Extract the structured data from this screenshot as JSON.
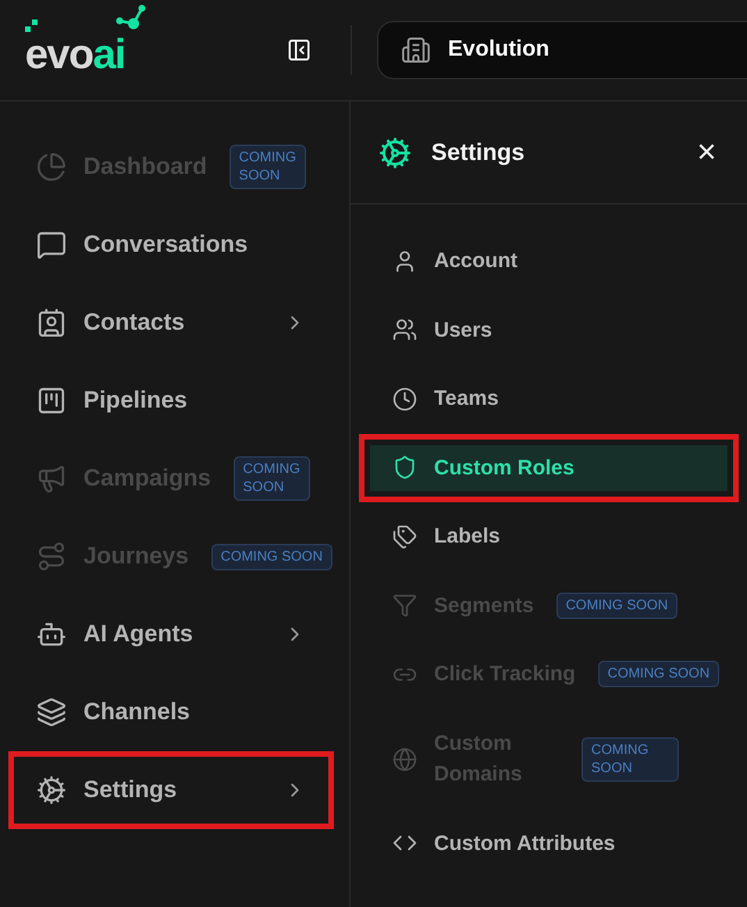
{
  "logo": {
    "part_1": "evo",
    "part_2": "ai"
  },
  "workspace": {
    "name": "Evolution"
  },
  "sidebar": {
    "items": [
      {
        "label": "Dashboard",
        "disabled": true,
        "badge": "COMING SOON",
        "has_children": false,
        "highlighted": false
      },
      {
        "label": "Conversations",
        "disabled": false,
        "has_children": false,
        "highlighted": false
      },
      {
        "label": "Contacts",
        "disabled": false,
        "has_children": true,
        "highlighted": false
      },
      {
        "label": "Pipelines",
        "disabled": false,
        "has_children": false,
        "highlighted": false
      },
      {
        "label": "Campaigns",
        "disabled": true,
        "badge": "COMING SOON",
        "has_children": false,
        "highlighted": false
      },
      {
        "label": "Journeys",
        "disabled": true,
        "badge": "COMING SOON",
        "has_children": false,
        "highlighted": false
      },
      {
        "label": "AI Agents",
        "disabled": false,
        "has_children": true,
        "highlighted": false
      },
      {
        "label": "Channels",
        "disabled": false,
        "has_children": false,
        "highlighted": false
      },
      {
        "label": "Settings",
        "disabled": false,
        "has_children": true,
        "highlighted": true
      }
    ]
  },
  "settings_panel": {
    "title": "Settings",
    "close": "×",
    "items": [
      {
        "label": "Account",
        "disabled": false,
        "selected": false,
        "highlighted": false
      },
      {
        "label": "Users",
        "disabled": false,
        "selected": false,
        "highlighted": false
      },
      {
        "label": "Teams",
        "disabled": false,
        "selected": false,
        "highlighted": false
      },
      {
        "label": "Custom Roles",
        "disabled": false,
        "selected": true,
        "highlighted": true
      },
      {
        "label": "Labels",
        "disabled": false,
        "selected": false,
        "highlighted": false
      },
      {
        "label": "Segments",
        "disabled": true,
        "badge": "COMING SOON",
        "selected": false,
        "highlighted": false
      },
      {
        "label": "Click Tracking",
        "disabled": true,
        "badge": "COMING SOON",
        "selected": false,
        "highlighted": false
      },
      {
        "label": "Custom Domains",
        "disabled": true,
        "badge": "COMING SOON",
        "selected": false,
        "highlighted": false
      },
      {
        "label": "Custom Attributes",
        "disabled": false,
        "selected": false,
        "highlighted": false
      }
    ]
  }
}
